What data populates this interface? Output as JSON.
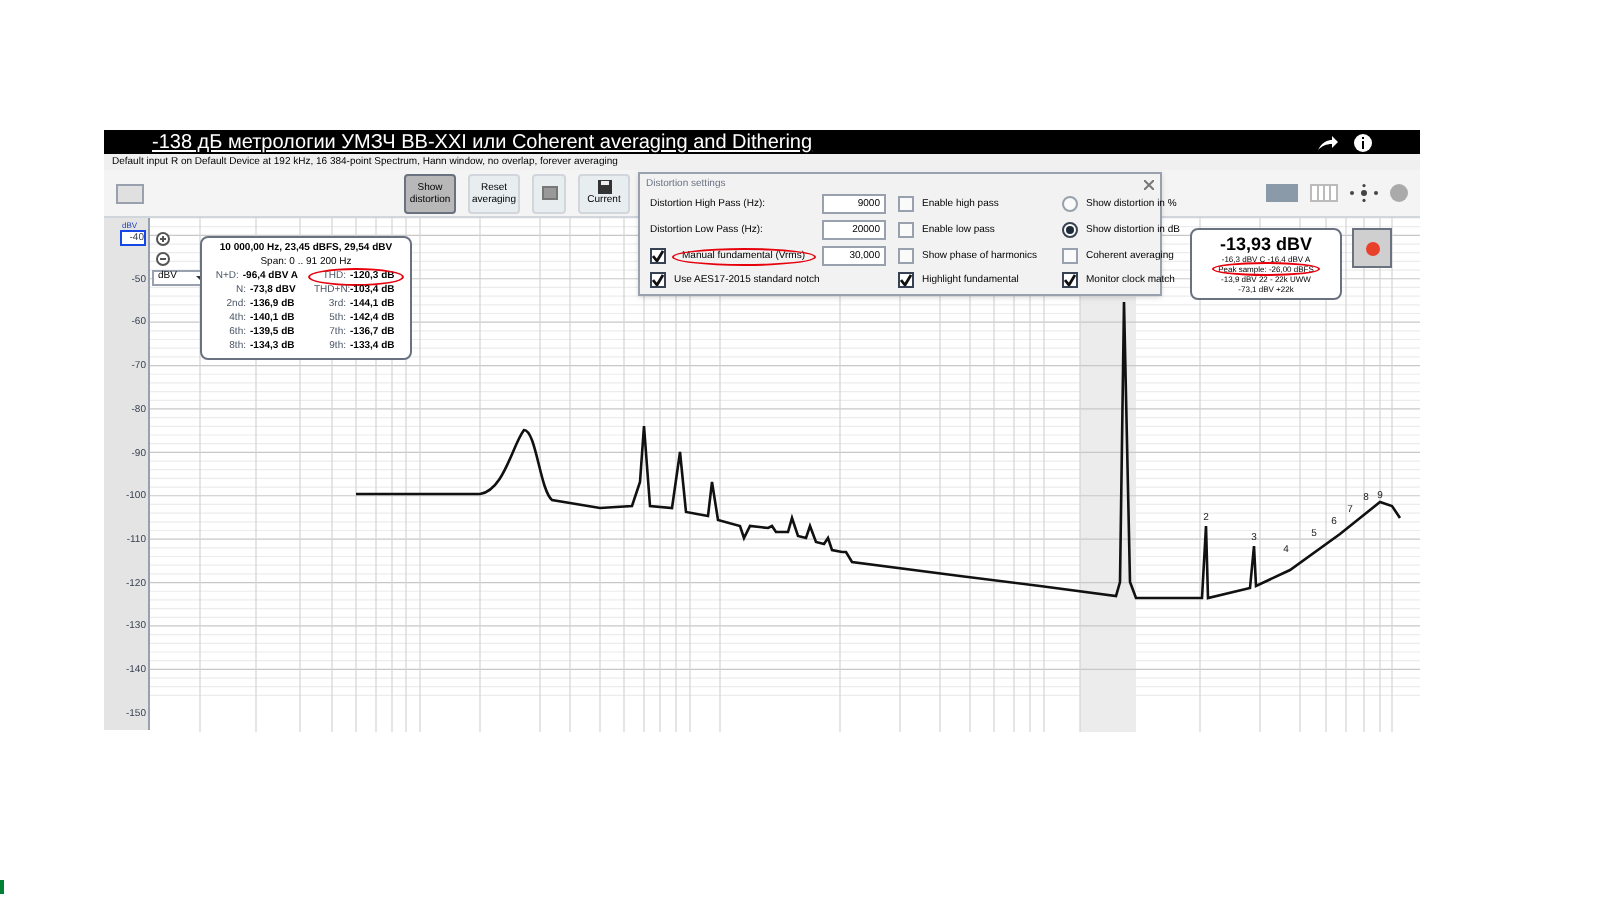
{
  "video_title": "-138 дБ метрологии УМЗЧ ВВ-XXI или Coherent averaging and Dithering",
  "window": {
    "title": "Default input R on Default Device at 192 kHz, 16 384-point Spectrum, Hann window, no overlap, forever averaging"
  },
  "toolbar": {
    "buttons": [
      {
        "kind": "text",
        "label": "Show distortion",
        "selected": true
      },
      {
        "kind": "text",
        "label": "Reset averaging",
        "selected": false
      },
      {
        "kind": "icon",
        "selected": false
      },
      {
        "kind": "save",
        "label": "Current",
        "selected": false
      }
    ]
  },
  "chart": {
    "unit_tag": "dBV",
    "y_labels": [
      "-40",
      "-50",
      "-60",
      "-70",
      "-80",
      "-90",
      "-100",
      "-110",
      "-120",
      "-130",
      "-140",
      "-150"
    ],
    "unit_select": "dBV",
    "harmonic_labels": [
      "2",
      "3",
      "4",
      "5",
      "6",
      "7",
      "8",
      "9"
    ]
  },
  "info_panel": {
    "header": "10 000,00 Hz, 23,45 dBFS, 29,54 dBV",
    "span": "Span: 0 .. 91 200 Hz",
    "cells": [
      {
        "label": "N+D:",
        "value": "-96,4 dBV A",
        "circled": false
      },
      {
        "label": "THD:",
        "value": "-120,3 dB",
        "circled": true
      },
      {
        "label": "N:",
        "value": "-73,8 dBV",
        "circled": false
      },
      {
        "label": "THD+N:",
        "value": "-103,4 dB",
        "circled": false
      },
      {
        "label": "2nd:",
        "value": "-136,9 dB",
        "circled": false
      },
      {
        "label": "3rd:",
        "value": "-144,1 dB",
        "circled": false
      },
      {
        "label": "4th:",
        "value": "-140,1 dB",
        "circled": false
      },
      {
        "label": "5th:",
        "value": "-142,4 dB",
        "circled": false
      },
      {
        "label": "6th:",
        "value": "-139,5 dB",
        "circled": false
      },
      {
        "label": "7th:",
        "value": "-136,7 dB",
        "circled": false
      },
      {
        "label": "8th:",
        "value": "-134,3 dB",
        "circled": false
      },
      {
        "label": "9th:",
        "value": "-133,4 dB",
        "circled": false
      }
    ]
  },
  "distortion_settings": {
    "title": "Distortion settings",
    "rows": [
      [
        {
          "kind": "field",
          "label": "Distortion High Pass (Hz):",
          "value": "9000"
        },
        {
          "kind": "checkbox",
          "label": "Enable high pass",
          "checked": false
        },
        {
          "kind": "radio",
          "label": "Show distortion in %",
          "selected": false
        }
      ],
      [
        {
          "kind": "field",
          "label": "Distortion Low Pass (Hz):",
          "value": "20000"
        },
        {
          "kind": "checkbox",
          "label": "Enable low pass",
          "checked": false
        },
        {
          "kind": "radio",
          "label": "Show distortion in dB",
          "selected": true
        }
      ],
      [
        {
          "kind": "checkfield",
          "label": "Manual fundamental (Vrms)",
          "value": "30,000",
          "checked": true,
          "circled": true
        },
        {
          "kind": "checkbox",
          "label": "Show phase of harmonics",
          "checked": false
        },
        {
          "kind": "checkbox",
          "label": "Coherent averaging",
          "checked": false
        }
      ],
      [
        {
          "kind": "checkbox",
          "label": "Use AES17-2015 standard notch",
          "checked": true
        },
        {
          "kind": "checkbox",
          "label": "Highlight fundamental",
          "checked": true
        },
        {
          "kind": "checkbox",
          "label": "Monitor clock match",
          "checked": true
        }
      ]
    ]
  },
  "level_meter": {
    "reading": "-13,93 dBV",
    "lines": [
      {
        "text": "-16,3 dBV C  -16,4 dBV A",
        "circled": false
      },
      {
        "text": "Peak sample: -26,00 dBFS",
        "circled": true
      },
      {
        "text": "-13,9 dBV 22 - 22k UWW",
        "circled": false
      },
      {
        "text": "-73,1 dBV +22k",
        "circled": false
      }
    ]
  }
}
